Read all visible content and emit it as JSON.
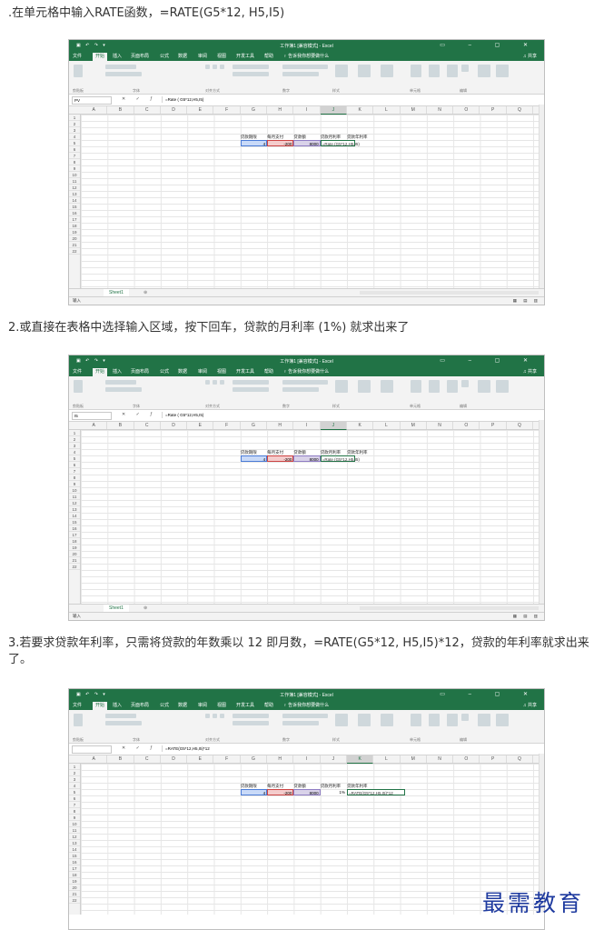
{
  "captions": {
    "step1": ".在单元格中输入RATE函数，=RATE(G5*12, H5,I5)",
    "step2": "2.或直接在表格中选择输入区域，按下回车，贷款的月利率 (1%) 就求出来了",
    "step3": "3.若要求贷款年利率，只需将贷款的年数乘以 12 即月数，=RATE(G5*12, H5,I5)*12，贷款的年利率就求出来了。"
  },
  "excel": {
    "window_title": "工作簿1 [兼容模式] - Excel",
    "tabs": [
      "文件",
      "开始",
      "插入",
      "页面布局",
      "公式",
      "数据",
      "审阅",
      "视图",
      "开发工具",
      "帮助"
    ],
    "active_tab": "开始",
    "tell_me": "♀ 告诉我你想要做什么",
    "share": "♫ 共享",
    "ribbon_groups": [
      "剪贴板",
      "字体",
      "对齐方式",
      "数字",
      "样式",
      "单元格",
      "编辑"
    ],
    "column_headers": [
      "A",
      "B",
      "C",
      "D",
      "E",
      "F",
      "G",
      "H",
      "I",
      "J",
      "K",
      "L",
      "M",
      "N",
      "O",
      "P",
      "Q"
    ],
    "row_headers": [
      "1",
      "2",
      "3",
      "4",
      "5",
      "6",
      "7",
      "8",
      "9",
      "10",
      "11",
      "12",
      "13",
      "14",
      "15",
      "16",
      "17",
      "18",
      "19",
      "20",
      "21",
      "22"
    ],
    "sheet_tab": "Sheet1",
    "status_left": "输入",
    "table_headers": {
      "g4": "贷款期限",
      "h4": "每月支付",
      "i4": "贷款额",
      "j4": "贷款月利率",
      "k4": "贷款年利率"
    },
    "values": {
      "g5": "4",
      "h5": "-200",
      "i5": "8000"
    }
  },
  "screens": [
    {
      "name_box": "PV",
      "formula_bar": "=Rate ( G5*12,H5,I5)",
      "selected_col": "J",
      "cell_j5": "=Rate (G5*12,H5,I5)",
      "cell_k5": ""
    },
    {
      "name_box": "I5",
      "formula_bar": "=Rate ( G5*12,H5,I5)",
      "selected_col": "J",
      "cell_j5": "=Rate (G5*12,H5,I5)",
      "cell_k5": ""
    },
    {
      "name_box": "",
      "formula_bar": "=RATE(G5*12,H5,I5)*12",
      "selected_col": "K",
      "cell_j5": "1%",
      "cell_k5": "=RATE(G5*12,H5,I5)*12"
    }
  ],
  "watermark": "最需教育"
}
